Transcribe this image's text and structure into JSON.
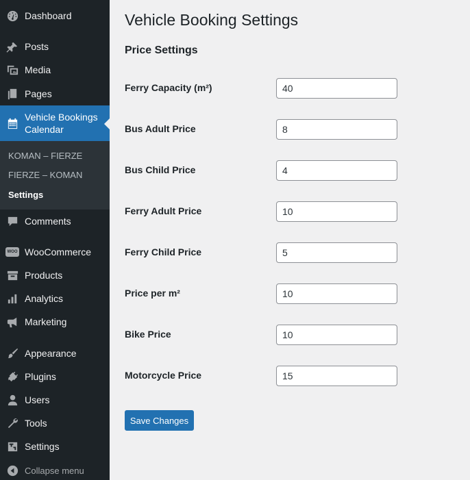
{
  "sidebar": {
    "dashboard": "Dashboard",
    "posts": "Posts",
    "media": "Media",
    "pages": "Pages",
    "current": "Vehicle Bookings Calendar",
    "submenu": [
      "KOMAN – FIERZE",
      "FIERZE – KOMAN",
      "Settings"
    ],
    "comments": "Comments",
    "woocommerce": "WooCommerce",
    "woo_icon_text": "WOO",
    "products": "Products",
    "analytics": "Analytics",
    "marketing": "Marketing",
    "appearance": "Appearance",
    "plugins": "Plugins",
    "users": "Users",
    "tools": "Tools",
    "settings": "Settings",
    "collapse": "Collapse menu"
  },
  "page": {
    "title": "Vehicle Booking Settings",
    "section_title": "Price Settings"
  },
  "fields": [
    {
      "label": "Ferry Capacity (m²)",
      "value": "40"
    },
    {
      "label": "Bus Adult Price",
      "value": "8"
    },
    {
      "label": "Bus Child Price",
      "value": "4"
    },
    {
      "label": "Ferry Adult Price",
      "value": "10"
    },
    {
      "label": "Ferry Child Price",
      "value": "5"
    },
    {
      "label": "Price per m²",
      "value": "10"
    },
    {
      "label": "Bike Price",
      "value": "10"
    },
    {
      "label": "Motorcycle Price",
      "value": "15"
    }
  ],
  "save_label": "Save Changes",
  "colors": {
    "sidebar_bg": "#1d2327",
    "accent": "#2271b1",
    "page_bg": "#f0f0f1"
  }
}
